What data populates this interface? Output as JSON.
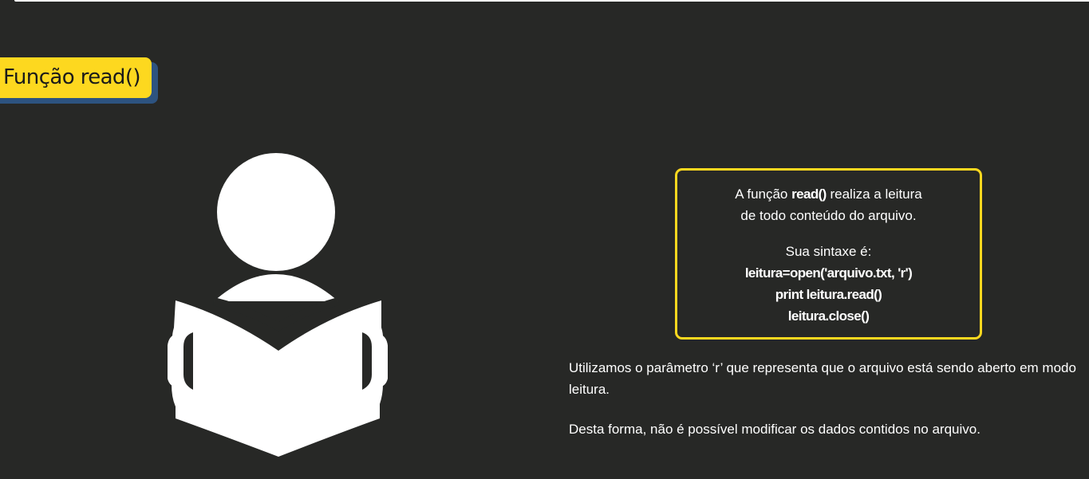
{
  "slide": {
    "title": "Função read()",
    "box": {
      "intro_prefix": "A função ",
      "intro_bold": "read()",
      "intro_suffix": " realiza a leitura",
      "intro_line2": "de todo conteúdo do arquivo.",
      "syntax_label": "Sua sintaxe é:",
      "code_lines": [
        "leitura=open('arquivo.txt, 'r')",
        "print leitura.read()",
        "leitura.close()"
      ]
    },
    "paragraph1": "Utilizamos o parâmetro ‘r’ que representa que o arquivo está sendo aberto em modo leitura.",
    "paragraph2": "Desta forma, não é possível modificar os dados contidos no arquivo.",
    "illustration_icon": "person-reading-book-icon"
  },
  "colors": {
    "background": "#272826",
    "accent_yellow": "#fdd81f",
    "shadow_blue": "#2d5380",
    "text": "#ffffff"
  }
}
